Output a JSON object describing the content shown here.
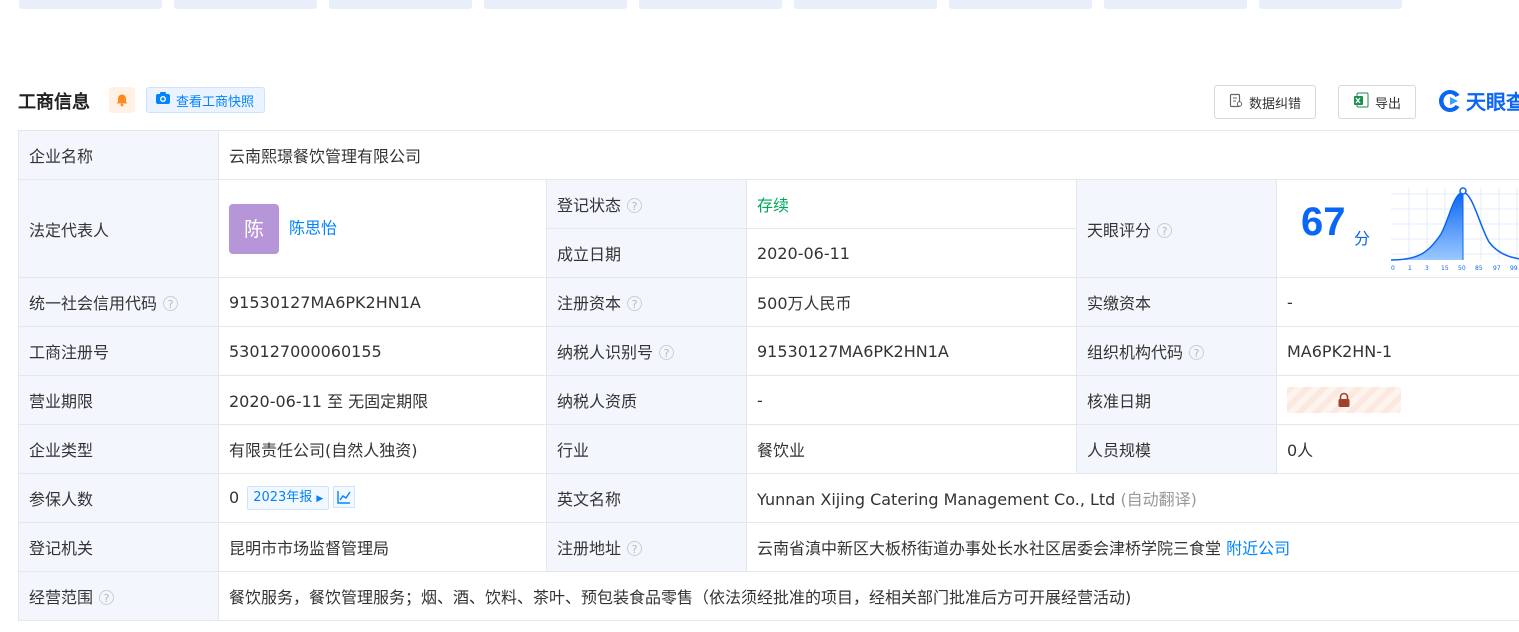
{
  "section": {
    "title": "工商信息",
    "snapshot_label": "查看工商快照",
    "correct_label": "数据纠错",
    "export_label": "导出",
    "brand": "天眼查"
  },
  "company": {
    "name_label": "企业名称",
    "name": "云南熙璟餐饮管理有限公司",
    "legal_rep_label": "法定代表人",
    "legal_rep_avatar": "陈",
    "legal_rep": "陈思怡",
    "status_label": "登记状态",
    "status": "存续",
    "est_date_label": "成立日期",
    "est_date": "2020-06-11",
    "score_label": "天眼评分",
    "score": "67",
    "score_unit": "分",
    "score_ticks": [
      "0",
      "1",
      "3",
      "15",
      "50",
      "85",
      "97",
      "99",
      "10"
    ],
    "credit_code_label": "统一社会信用代码",
    "credit_code": "91530127MA6PK2HN1A",
    "reg_capital_label": "注册资本",
    "reg_capital": "500万人民币",
    "paid_capital_label": "实缴资本",
    "paid_capital": "-",
    "reg_no_label": "工商注册号",
    "reg_no": "530127000060155",
    "taxpayer_id_label": "纳税人识别号",
    "taxpayer_id": "91530127MA6PK2HN1A",
    "org_code_label": "组织机构代码",
    "org_code": "MA6PK2HN-1",
    "term_label": "营业期限",
    "term": "2020-06-11 至 无固定期限",
    "tax_qual_label": "纳税人资质",
    "tax_qual": "-",
    "approve_date_label": "核准日期",
    "type_label": "企业类型",
    "type": "有限责任公司(自然人独资)",
    "industry_label": "行业",
    "industry": "餐饮业",
    "staff_size_label": "人员规模",
    "staff_size": "0人",
    "insured_label": "参保人数",
    "insured": "0",
    "insured_report": "2023年报",
    "english_name_label": "英文名称",
    "english_name": "Yunnan Xijing Catering Management Co., Ltd",
    "english_note": "(自动翻译)",
    "authority_label": "登记机关",
    "authority": "昆明市市场监督管理局",
    "address_label": "注册地址",
    "address": "云南省滇中新区大板桥街道办事处长水社区居委会津桥学院三食堂",
    "nearby_label": "附近公司",
    "scope_label": "经营范围",
    "scope": "餐饮服务，餐饮管理服务；烟、酒、饮料、茶叶、预包装食品零售（依法须经批准的项目，经相关部门批准后方可开展经营活动)"
  },
  "colors": {
    "accent": "#0084ff",
    "brand": "#0a66f5",
    "status_green": "#00a85a",
    "label_bg": "#f3f7fd"
  }
}
